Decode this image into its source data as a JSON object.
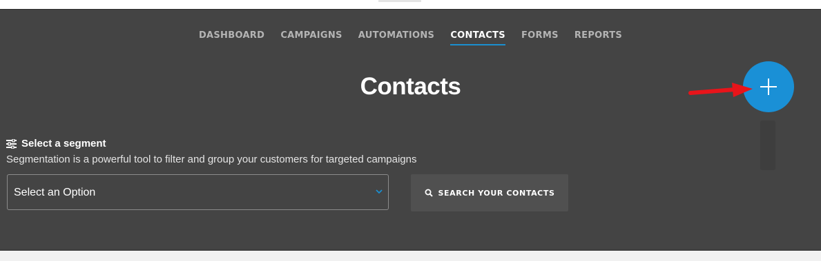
{
  "nav": {
    "items": [
      {
        "label": "DASHBOARD",
        "active": false
      },
      {
        "label": "CAMPAIGNS",
        "active": false
      },
      {
        "label": "AUTOMATIONS",
        "active": false
      },
      {
        "label": "CONTACTS",
        "active": true
      },
      {
        "label": "FORMS",
        "active": false
      },
      {
        "label": "REPORTS",
        "active": false
      }
    ]
  },
  "page": {
    "title": "Contacts"
  },
  "add_button": {
    "icon": "plus-icon",
    "color": "#1a90d6"
  },
  "annotation": {
    "icon": "red-arrow-icon",
    "color": "#e8141a"
  },
  "segment": {
    "icon": "sliders-icon",
    "title": "Select a segment",
    "description": "Segmentation is a powerful tool to filter and group your customers for targeted campaigns",
    "select": {
      "value": "Select an Option",
      "chevron_icon": "chevron-down-icon"
    },
    "search_button": {
      "icon": "search-icon",
      "label": "SEARCH YOUR CONTACTS"
    }
  },
  "colors": {
    "panel_bg": "#444444",
    "accent": "#1a8fd0"
  }
}
